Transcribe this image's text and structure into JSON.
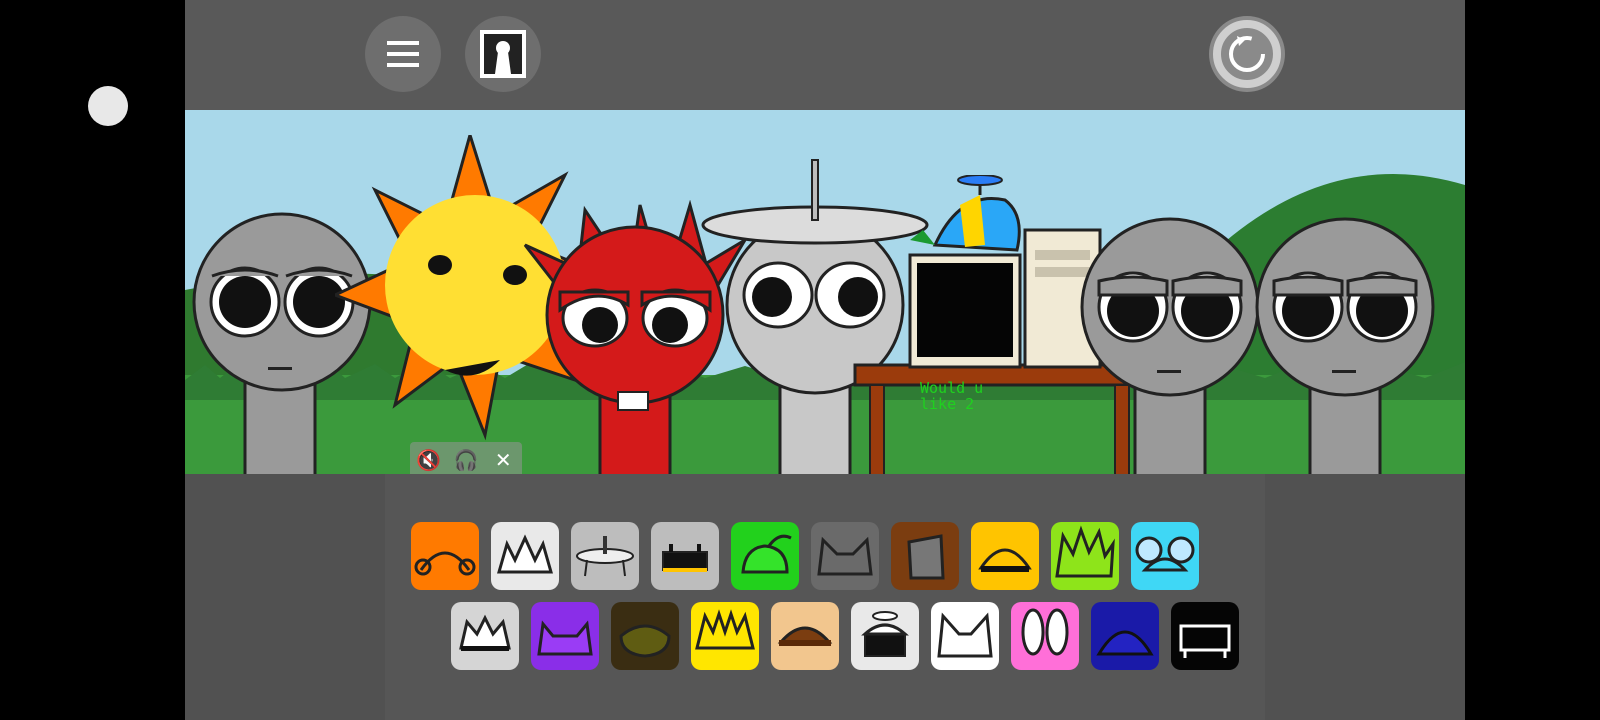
{
  "scene": {
    "computer_screen_text": "Would u like 2"
  },
  "topbar": {
    "menu_icon": "hamburger-menu-icon",
    "profile_icon": "keyhole-portrait-icon",
    "reset_icon": "reset-icon"
  },
  "audio_controls": {
    "mute_icon": "mute-icon",
    "headphones_icon": "headphones-icon",
    "close_icon": "close-icon"
  },
  "colors": {
    "game_bg": "#595959",
    "sky": "#a9d8ea",
    "grass": "#3b9a3c",
    "character_gray": "#8f8f8f"
  },
  "palette": {
    "row1": [
      {
        "name": "orange-headphones",
        "bg": "#ff7a00"
      },
      {
        "name": "white-spiky",
        "bg": "#e9e9e9"
      },
      {
        "name": "satellite-dish",
        "bg": "#bdbdbd"
      },
      {
        "name": "robot-visor",
        "bg": "#bdbdbd"
      },
      {
        "name": "green-leaf",
        "bg": "#22d11c"
      },
      {
        "name": "gray-cat-ears",
        "bg": "#6a6a6a"
      },
      {
        "name": "brown-bucket",
        "bg": "#7b3d10"
      },
      {
        "name": "yellow-helmet",
        "bg": "#ffc400"
      },
      {
        "name": "lime-spiky",
        "bg": "#8ee41a"
      },
      {
        "name": "cyan-mouse-ears",
        "bg": "#3fd7f5"
      }
    ],
    "row2": [
      {
        "name": "white-crown",
        "bg": "#d5d5d5"
      },
      {
        "name": "purple-horns",
        "bg": "#8a2ee8"
      },
      {
        "name": "dark-olive-bowl",
        "bg": "#3a2d12"
      },
      {
        "name": "yellow-lightning",
        "bg": "#ffe600"
      },
      {
        "name": "tan-hair",
        "bg": "#f2c68e"
      },
      {
        "name": "propeller-cap",
        "bg": "#e9e9e9"
      },
      {
        "name": "white-cat-ears",
        "bg": "#ffffff"
      },
      {
        "name": "pink-bunny-ears",
        "bg": "#ff6fd8"
      },
      {
        "name": "navy-helmet",
        "bg": "#1a1aa8"
      },
      {
        "name": "black-box",
        "bg": "#050505"
      }
    ]
  }
}
